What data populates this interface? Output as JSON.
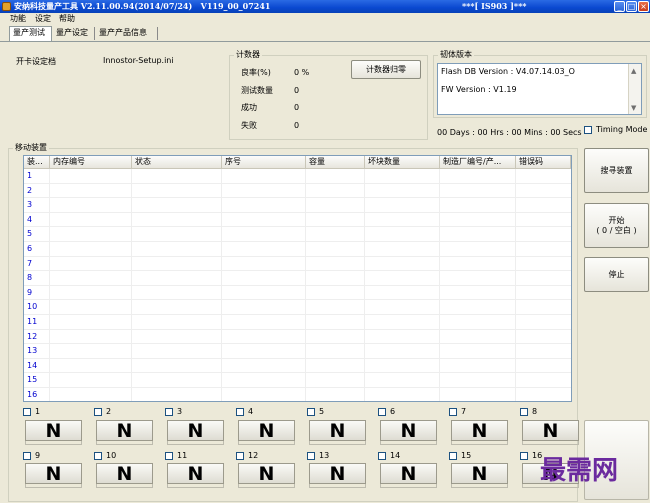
{
  "window": {
    "title": "安纳科技量产工具 V2.11.00.94(2014/07/24)   V119_00_07241",
    "title_right": "***[ IS903 ]***"
  },
  "menu": [
    "功能",
    "设定",
    "帮助"
  ],
  "tabs": [
    "量产测试",
    "量产设定",
    "量产产品信息"
  ],
  "config": {
    "label": "开卡设定档",
    "file": "Innostor-Setup.ini"
  },
  "counter": {
    "title": "计数器",
    "rows": [
      {
        "label": "良率(%)",
        "value": "0 %"
      },
      {
        "label": "测试数量",
        "value": "0"
      },
      {
        "label": "成功",
        "value": "0"
      },
      {
        "label": "失败",
        "value": "0"
      }
    ],
    "reset_button": "计数器归零"
  },
  "firmware": {
    "title": "韧体版本",
    "flash_db": "Flash DB Version :  V4.07.14.03_O",
    "fw": "FW Version :  V1.19"
  },
  "timer": "00 Days : 00 Hrs : 00 Mins : 00 Secs",
  "timing_mode": "Timing Mode",
  "device_list": {
    "title": "移动装置",
    "columns": [
      "装...",
      "内存编号",
      "状态",
      "序号",
      "容量",
      "坏块数量",
      "制造厂编号/产...",
      "错误码"
    ],
    "rows": [
      "1",
      "2",
      "3",
      "4",
      "5",
      "6",
      "7",
      "8",
      "9",
      "10",
      "11",
      "12",
      "13",
      "14",
      "15",
      "16"
    ]
  },
  "buttons": {
    "search": "搜寻装置",
    "start": "开始",
    "start_sub": "( 0 / 空白 )",
    "stop": "停止"
  },
  "ports": [
    "1",
    "2",
    "3",
    "4",
    "5",
    "6",
    "7",
    "8",
    "9",
    "10",
    "11",
    "12",
    "13",
    "14",
    "15",
    "16"
  ],
  "port_status": "N",
  "watermark": "最需网"
}
